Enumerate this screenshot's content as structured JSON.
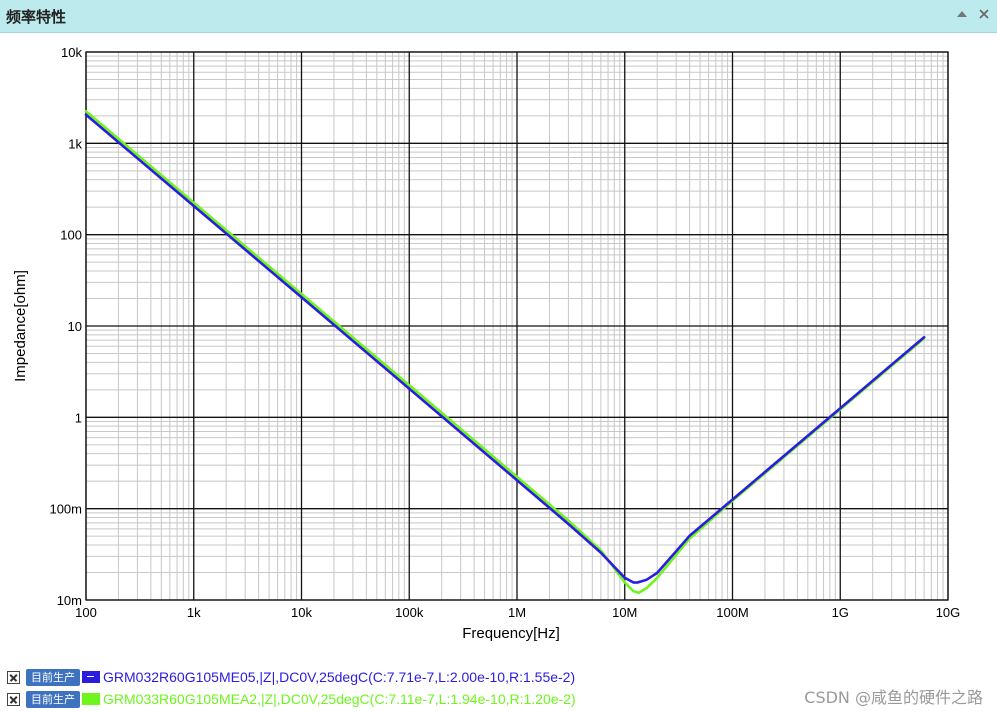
{
  "window": {
    "title": "频率特性",
    "controls": [
      {
        "icon": "collapse-up-triangle-icon"
      },
      {
        "icon": "close-x-icon"
      }
    ]
  },
  "chart_data": {
    "type": "line",
    "xlabel": "Frequency[Hz]",
    "ylabel": "Impedance[ohm]",
    "x_scale": "log",
    "y_scale": "log",
    "xlim": [
      100,
      10000000000
    ],
    "ylim": [
      0.01,
      10000
    ],
    "x_ticks": [
      {
        "value": 100,
        "label": "100"
      },
      {
        "value": 1000,
        "label": "1k"
      },
      {
        "value": 10000,
        "label": "10k"
      },
      {
        "value": 100000,
        "label": "100k"
      },
      {
        "value": 1000000,
        "label": "1M"
      },
      {
        "value": 10000000,
        "label": "10M"
      },
      {
        "value": 100000000,
        "label": "100M"
      },
      {
        "value": 1000000000,
        "label": "1G"
      },
      {
        "value": 10000000000,
        "label": "10G"
      }
    ],
    "y_ticks": [
      {
        "value": 0.01,
        "label": "10m"
      },
      {
        "value": 0.1,
        "label": "100m"
      },
      {
        "value": 1,
        "label": "1"
      },
      {
        "value": 10,
        "label": "10"
      },
      {
        "value": 100,
        "label": "100"
      },
      {
        "value": 1000,
        "label": "1k"
      },
      {
        "value": 10000,
        "label": "10k"
      }
    ],
    "grid": true,
    "minor_grid": true,
    "legend_position": "bottom-left",
    "series": [
      {
        "name": "GRM032R60G105ME05,|Z|,DC0V,25degC(C:7.71e-7,L:2.00e-10,R:1.55e-2)",
        "status": "目前生产",
        "color": "#2b1de0",
        "x": [
          100,
          1000,
          10000,
          100000,
          1000000,
          3000000,
          6000000,
          10000000,
          12000000,
          13000000,
          16000000,
          20000000,
          40000000,
          100000000,
          1000000000,
          6000000000
        ],
        "y": [
          2060,
          206,
          20.6,
          2.06,
          0.205,
          0.068,
          0.033,
          0.0175,
          0.0156,
          0.0155,
          0.0167,
          0.0198,
          0.0505,
          0.126,
          1.26,
          7.54
        ]
      },
      {
        "name": "GRM033R60G105MEA2,|Z|,DC0V,25degC(C:7.11e-7,L:1.94e-10,R:1.20e-2)",
        "status": "目前生产",
        "color": "#6ef51c",
        "x": [
          100,
          1000,
          10000,
          100000,
          1000000,
          3000000,
          6000000,
          10000000,
          12000000,
          13500000,
          16000000,
          20000000,
          40000000,
          100000000,
          1000000000,
          6000000000
        ],
        "y": [
          2240,
          224,
          22.4,
          2.24,
          0.223,
          0.074,
          0.035,
          0.0156,
          0.0125,
          0.012,
          0.0135,
          0.0175,
          0.047,
          0.122,
          1.22,
          7.31
        ]
      }
    ]
  },
  "watermark": "CSDN @咸鱼的硬件之路"
}
